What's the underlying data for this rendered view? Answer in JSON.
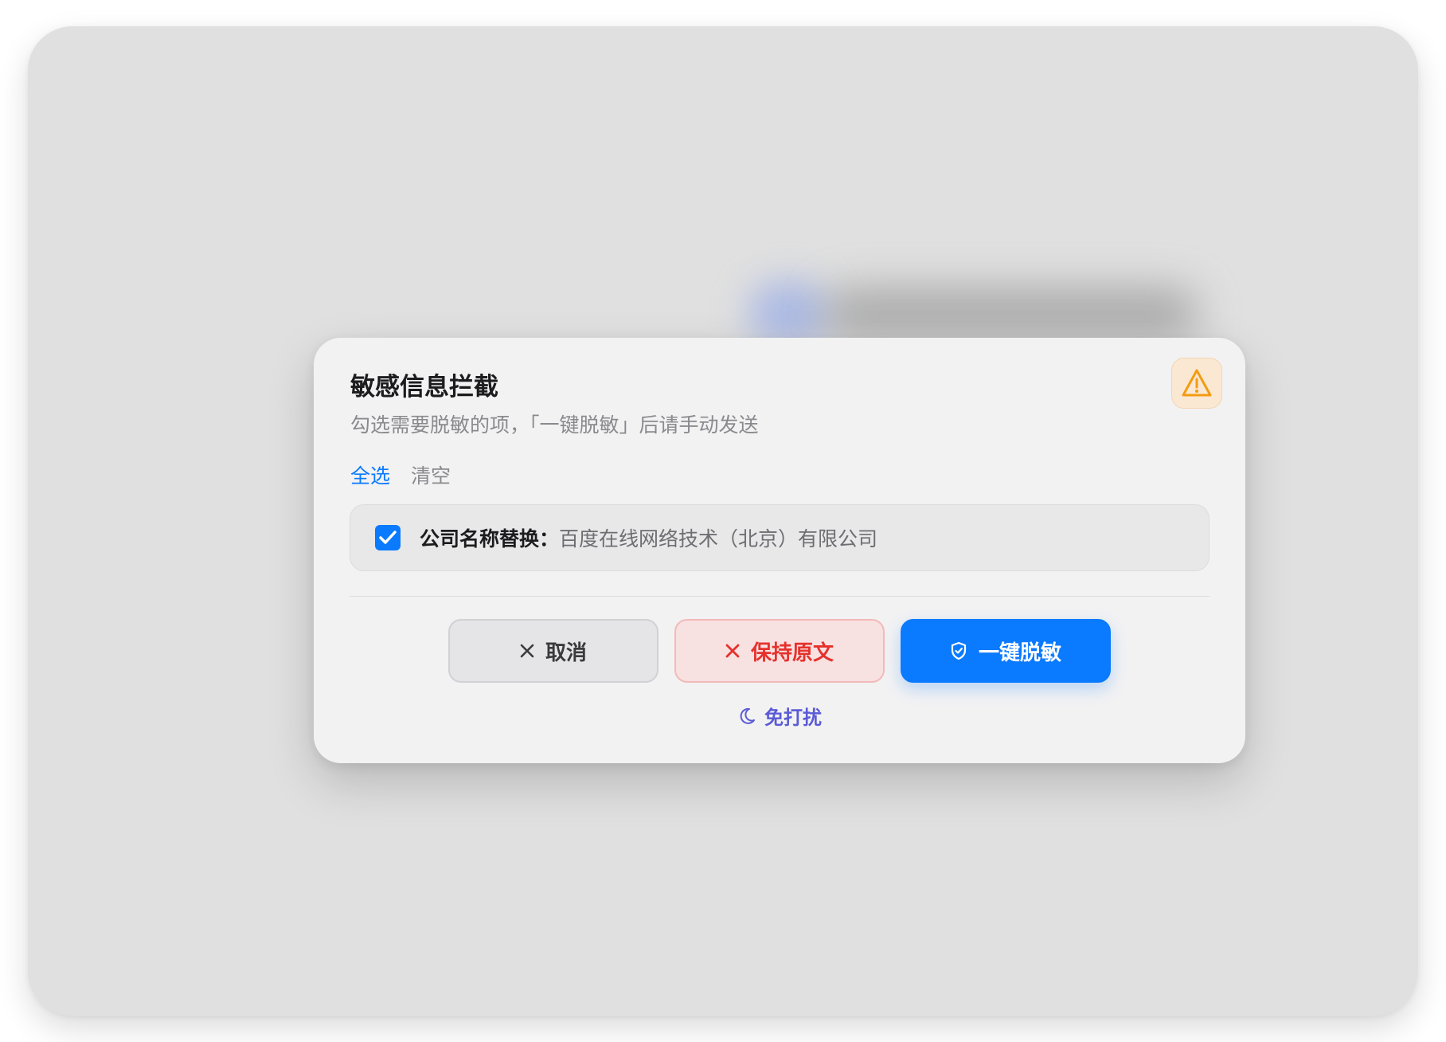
{
  "dialog": {
    "title": "敏感信息拦截",
    "subtitle": "勾选需要脱敏的项，「一键脱敏」后请手动发送",
    "warning_icon": "warning-triangle-icon"
  },
  "quick_actions": {
    "select_all": "全选",
    "clear": "清空"
  },
  "items": [
    {
      "checked": true,
      "label": "公司名称替换：",
      "value": "百度在线网络技术（北京）有限公司"
    }
  ],
  "buttons": {
    "cancel": {
      "label": "取消",
      "icon": "close-icon"
    },
    "keep_original": {
      "label": "保持原文",
      "icon": "close-icon"
    },
    "redact": {
      "label": "一键脱敏",
      "icon": "shield-check-icon"
    }
  },
  "do_not_disturb": {
    "label": "免打扰",
    "icon": "moon-icon"
  },
  "colors": {
    "accent": "#0a7aff",
    "danger": "#e5322d",
    "warning": "#f39c12",
    "dnd": "#5b5bd6"
  }
}
